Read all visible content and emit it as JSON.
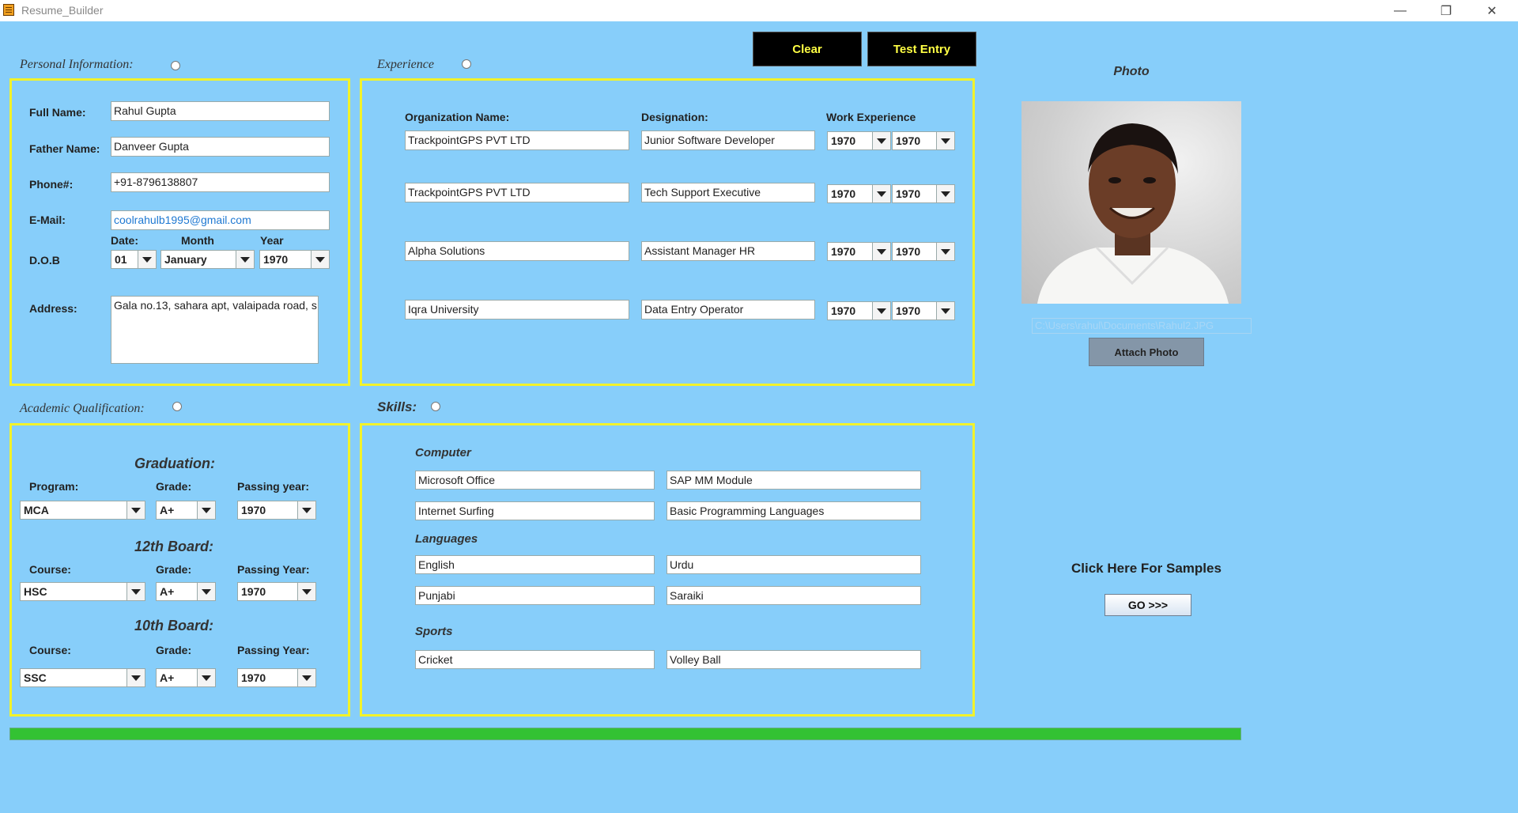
{
  "window": {
    "title": "Resume_Builder",
    "minimize": "—",
    "maximize": "❐",
    "close": "✕"
  },
  "toolbar": {
    "clear_label": "Clear",
    "test_entry_label": "Test Entry"
  },
  "personal": {
    "title": "Personal Information:",
    "full_name_label": "Full Name:",
    "full_name": "Rahul Gupta",
    "father_label": "Father Name:",
    "father": "Danveer Gupta",
    "phone_label": "Phone#:",
    "phone": "+91-8796138807",
    "email_label": "E-Mail:",
    "email": "coolrahulb1995@gmail.com",
    "dob_label": "D.O.B",
    "date_label": "Date:",
    "month_label": "Month",
    "year_label": "Year",
    "dob_date": "01",
    "dob_month": "January",
    "dob_year": "1970",
    "address_label": "Address:",
    "address": "Gala no.13, sahara apt, valaipada road, s"
  },
  "experience": {
    "title": "Experience",
    "org_header": "Organization Name:",
    "designation_header": "Designation:",
    "work_header": "Work Experience",
    "rows": [
      {
        "org": "TrackpointGPS PVT LTD",
        "designation": "Junior Software Developer",
        "from": "1970",
        "to": "1970"
      },
      {
        "org": "TrackpointGPS PVT LTD",
        "designation": "Tech Support Executive",
        "from": "1970",
        "to": "1970"
      },
      {
        "org": "Alpha Solutions",
        "designation": "Assistant Manager HR",
        "from": "1970",
        "to": "1970"
      },
      {
        "org": "Iqra University",
        "designation": "Data Entry Operator",
        "from": "1970",
        "to": "1970"
      }
    ]
  },
  "photo": {
    "title": "Photo",
    "path": "C:\\Users\\rahul\\Documents\\Rahul2.JPG",
    "attach_label": "Attach Photo"
  },
  "academic": {
    "title": "Academic Qualification:",
    "graduation": {
      "heading": "Graduation:",
      "program_label": "Program:",
      "grade_label": "Grade:",
      "year_label": "Passing year:",
      "program": "MCA",
      "grade": "A+",
      "year": "1970"
    },
    "twelfth": {
      "heading": "12th Board:",
      "course_label": "Course:",
      "grade_label": "Grade:",
      "year_label": "Passing Year:",
      "course": "HSC",
      "grade": "A+",
      "year": "1970"
    },
    "tenth": {
      "heading": "10th Board:",
      "course_label": "Course:",
      "grade_label": "Grade:",
      "year_label": "Passing Year:",
      "course": "SSC",
      "grade": "A+",
      "year": "1970"
    }
  },
  "skills": {
    "title": "Skills:",
    "computer_heading": "Computer",
    "computer": [
      "Microsoft Office",
      "SAP MM Module",
      "Internet Surfing",
      "Basic Programming Languages"
    ],
    "languages_heading": "Languages",
    "languages": [
      "English",
      "Urdu",
      "Punjabi",
      "Saraiki"
    ],
    "sports_heading": "Sports",
    "sports": [
      "Cricket",
      "Volley Ball"
    ]
  },
  "samples": {
    "label": "Click Here For Samples",
    "go_label": "GO >>>"
  },
  "progress": {
    "value": 1.0
  },
  "colors": {
    "background": "#87cefa",
    "panel_border": "#f2f22a",
    "button_bg": "#000000",
    "button_text": "#ffff44",
    "progress": "#33c233"
  }
}
